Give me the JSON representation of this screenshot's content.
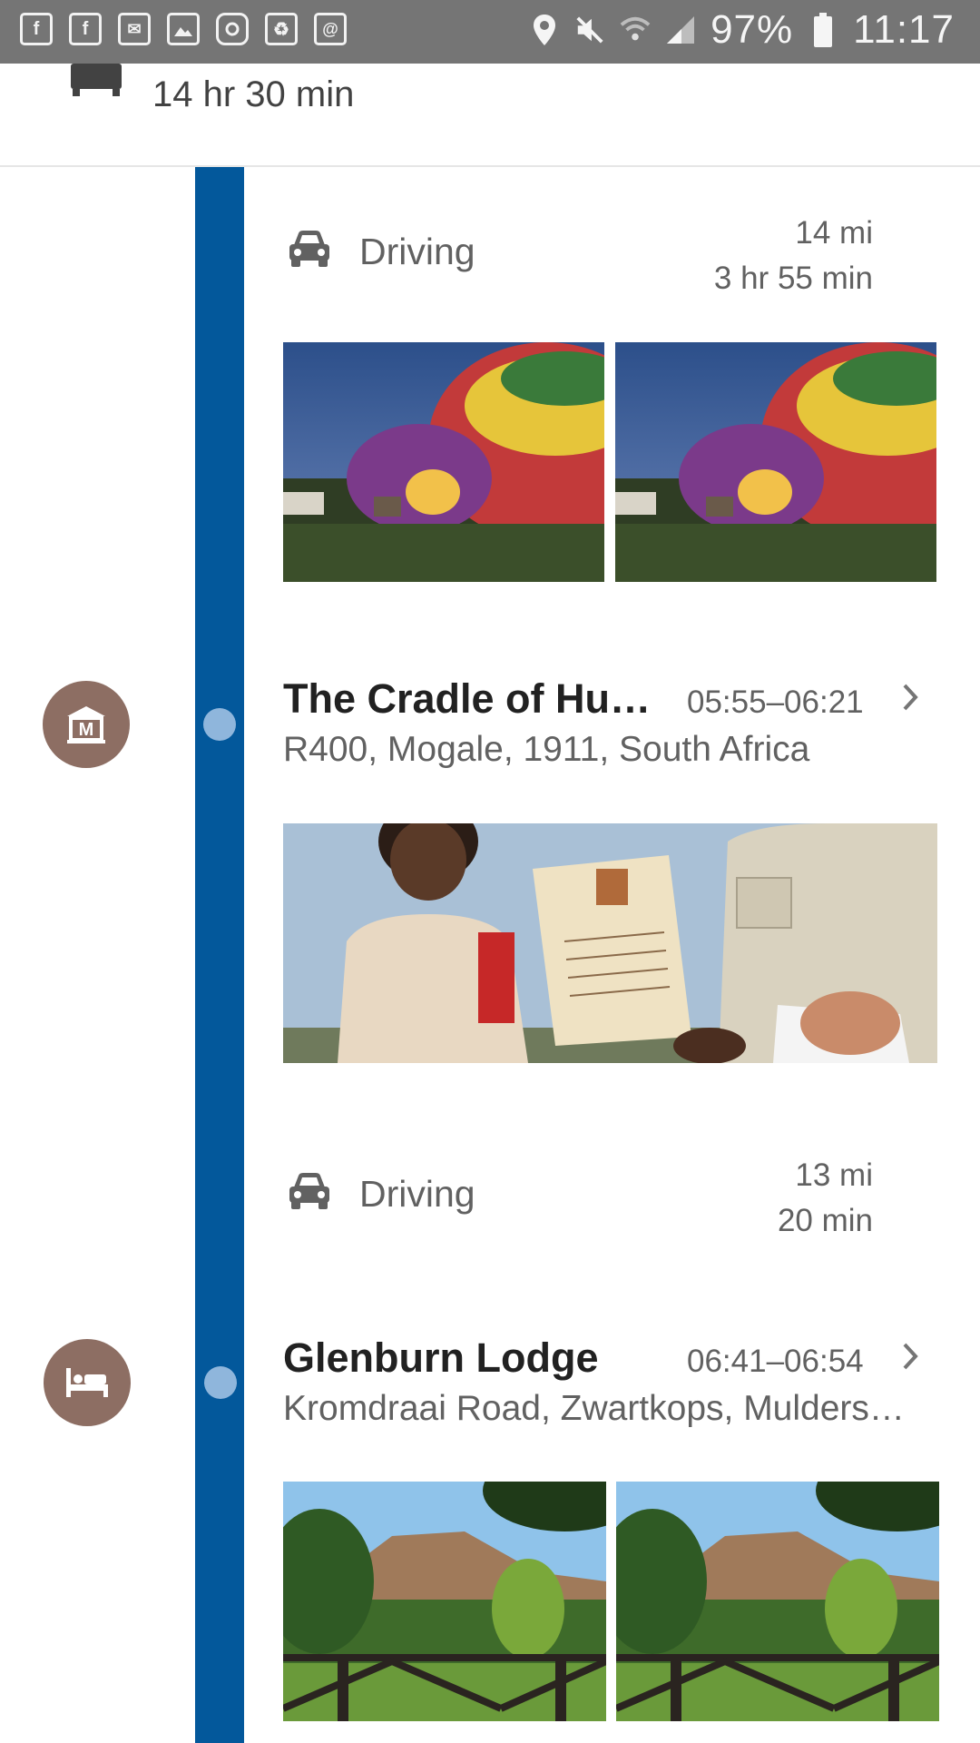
{
  "status_bar": {
    "app_icons": [
      "facebook-icon",
      "facebook-icon",
      "mail-icon",
      "gallery-icon",
      "instagram-icon",
      "recycle-icon",
      "email-at-icon"
    ],
    "battery_percent": "97%",
    "time": "11:17"
  },
  "summary": {
    "icon": "bed-icon",
    "total_time": "14 hr 30 min"
  },
  "timeline": {
    "items": [
      {
        "type": "driving",
        "label": "Driving",
        "distance": "14 mi",
        "duration": "3 hr 55 min"
      },
      {
        "type": "photos",
        "photos": [
          "hot-air-balloon-photo",
          "hot-air-balloon-photo"
        ]
      },
      {
        "type": "place",
        "icon": "museum-icon",
        "name": "The Cradle of Hu…",
        "time_range": "05:55–06:21",
        "address": "R400, Mogale, 1911, South Africa"
      },
      {
        "type": "photos",
        "photos": [
          "certificate-photo"
        ]
      },
      {
        "type": "driving",
        "label": "Driving",
        "distance": "13 mi",
        "duration": "20 min"
      },
      {
        "type": "place",
        "icon": "bed-icon",
        "name": "Glenburn Lodge",
        "time_range": "06:41–06:54",
        "address": "Kromdraai Road, Zwartkops, Mulders…"
      },
      {
        "type": "photos",
        "photos": [
          "lodge-landscape-photo",
          "lodge-landscape-photo"
        ]
      }
    ]
  },
  "colors": {
    "timeline": "#03589b",
    "dot": "#8fb6dc",
    "badge": "#8d6e63",
    "status_bar": "#757575"
  }
}
